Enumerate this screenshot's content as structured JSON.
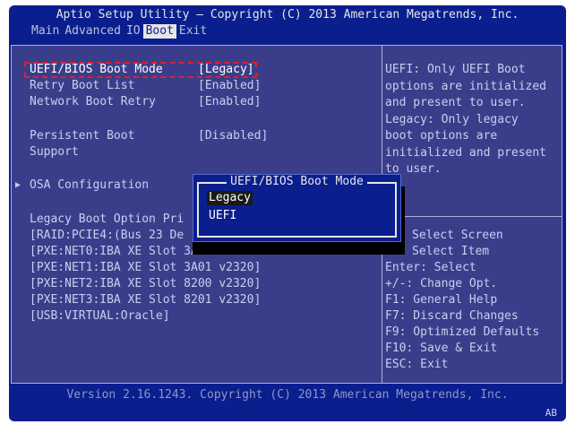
{
  "header": {
    "title": "Aptio Setup Utility – Copyright (C) 2013 American Megatrends, Inc."
  },
  "menu": [
    {
      "label": "Main",
      "active": false
    },
    {
      "label": "Advanced",
      "active": false
    },
    {
      "label": "IO",
      "active": false
    },
    {
      "label": "Boot",
      "active": true
    },
    {
      "label": "Exit",
      "active": false
    }
  ],
  "settings": {
    "boot_mode_label": "UEFI/BIOS Boot Mode",
    "boot_mode_value": "[Legacy]",
    "retry_label": "Retry Boot List",
    "retry_value": "[Enabled]",
    "net_retry_label": "Network Boot Retry",
    "net_retry_value": "[Enabled]",
    "persistent_label_1": "Persistent Boot",
    "persistent_label_2": "Support",
    "persistent_value": "[Disabled]",
    "osa_label": "OSA Configuration",
    "legacy_header": "Legacy Boot Option Pri",
    "options": [
      "[RAID:PCIE4:(Bus 23 De",
      "[PXE:NET0:IBA XE Slot 3A",
      "[PXE:NET1:IBA XE Slot 3A01 v2320]",
      "[PXE:NET2:IBA XE Slot 8200 v2320]",
      "[PXE:NET3:IBA XE Slot 8201 v2320]",
      "[USB:VIRTUAL:Oracle]"
    ]
  },
  "help": {
    "lines": [
      "UEFI: Only UEFI Boot",
      "options are initialized",
      "and present to user.",
      "Legacy: Only legacy",
      "boot options are",
      "initialized and present",
      "to user."
    ]
  },
  "keys": {
    "lines": [
      "Select Screen",
      "Select Item",
      "Enter: Select",
      "+/-: Change Opt.",
      "F1: General Help",
      "F7: Discard Changes",
      "F9: Optimized Defaults",
      "F10: Save & Exit",
      "ESC: Exit"
    ]
  },
  "popup": {
    "title": "UEFI/BIOS Boot Mode",
    "options": [
      "Legacy",
      "UEFI"
    ],
    "selected": "Legacy"
  },
  "footer": {
    "text": "Version 2.16.1243. Copyright (C) 2013 American Megatrends, Inc.",
    "corner": "AB"
  },
  "colors": {
    "background": "#0a1e8e",
    "panel": "#3a3e8a",
    "highlight_border": "#e0202a"
  }
}
